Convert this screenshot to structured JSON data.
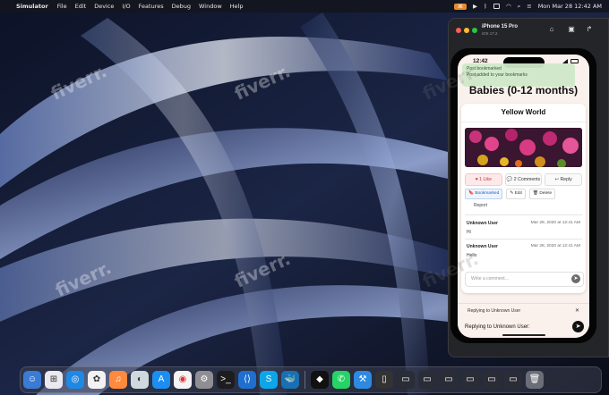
{
  "menubar": {
    "app_name": "Simulator",
    "items": [
      "File",
      "Edit",
      "Device",
      "I/O",
      "Features",
      "Debug",
      "Window",
      "Help"
    ],
    "status_pill": "⌘",
    "clock": "Mon Mar 28  12:42 AM"
  },
  "simulator": {
    "device_name": "iPhone 15 Pro",
    "os_version": "iOS 17.2"
  },
  "phone": {
    "status_time": "12:42",
    "toast_line1": "Post bookmarked",
    "toast_line2": "Post added to your bookmarks",
    "page_title": "Babies (0-12 months)",
    "card_title": "Yellow World",
    "like_label": "1 Like",
    "comments_label": "2 Comments",
    "reply_label": "Reply",
    "bookmark_label": "Bookmarked",
    "edit_label": "Edit",
    "delete_label": "Delete",
    "report_label": "Report",
    "comments": [
      {
        "user": "Unknown User",
        "date": "Mar 28, 2020 at 12:41 AM",
        "text": "Hi"
      },
      {
        "user": "Unknown User",
        "date": "Mar 28, 2020 at 12:41 AM",
        "text": "Hello"
      }
    ],
    "comment_placeholder": "Write a comment...",
    "reply_sheet_line1": "Replying to Unknown User",
    "reply_sheet_line2": "Replying to Unknown User:"
  },
  "watermark": "fiverr."
}
